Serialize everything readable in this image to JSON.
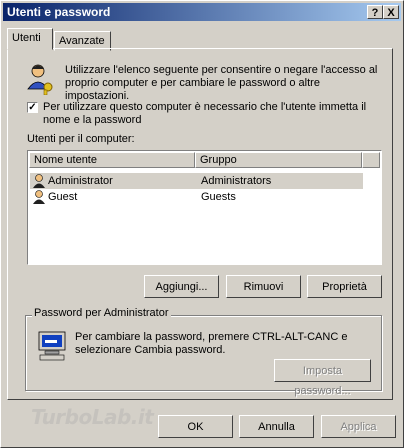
{
  "window": {
    "title": "Utenti e password",
    "help_btn": "?",
    "close_btn": "X"
  },
  "tabs": [
    {
      "label": "Utenti",
      "active": true
    },
    {
      "label": "Avanzate",
      "active": false
    }
  ],
  "intro": {
    "text": "Utilizzare l'elenco seguente per consentire o negare l'accesso al proprio computer e per cambiare le password o altre impostazioni.",
    "icon": "users-key-icon"
  },
  "require_password": {
    "checked": true,
    "label": "Per utilizzare questo computer è necessario che l'utente immetta il nome e la password"
  },
  "users_label": "Utenti per il computer:",
  "users_table": {
    "columns": [
      "Nome utente",
      "Gruppo"
    ],
    "rows": [
      {
        "name": "Administrator",
        "group": "Administrators",
        "selected": true
      },
      {
        "name": "Guest",
        "group": "Guests",
        "selected": false
      }
    ]
  },
  "user_buttons": {
    "add": "Aggiungi...",
    "remove": "Rimuovi",
    "properties": "Proprietà"
  },
  "password_group": {
    "title": "Password per Administrator",
    "text": "Per cambiare la password, premere CTRL-ALT-CANC e selezionare Cambia password.",
    "set_button": "Imposta password...",
    "icon": "computer-password-icon"
  },
  "dialog_buttons": {
    "ok": "OK",
    "cancel": "Annulla",
    "apply": "Applica"
  },
  "watermark": "TurboLab.it"
}
